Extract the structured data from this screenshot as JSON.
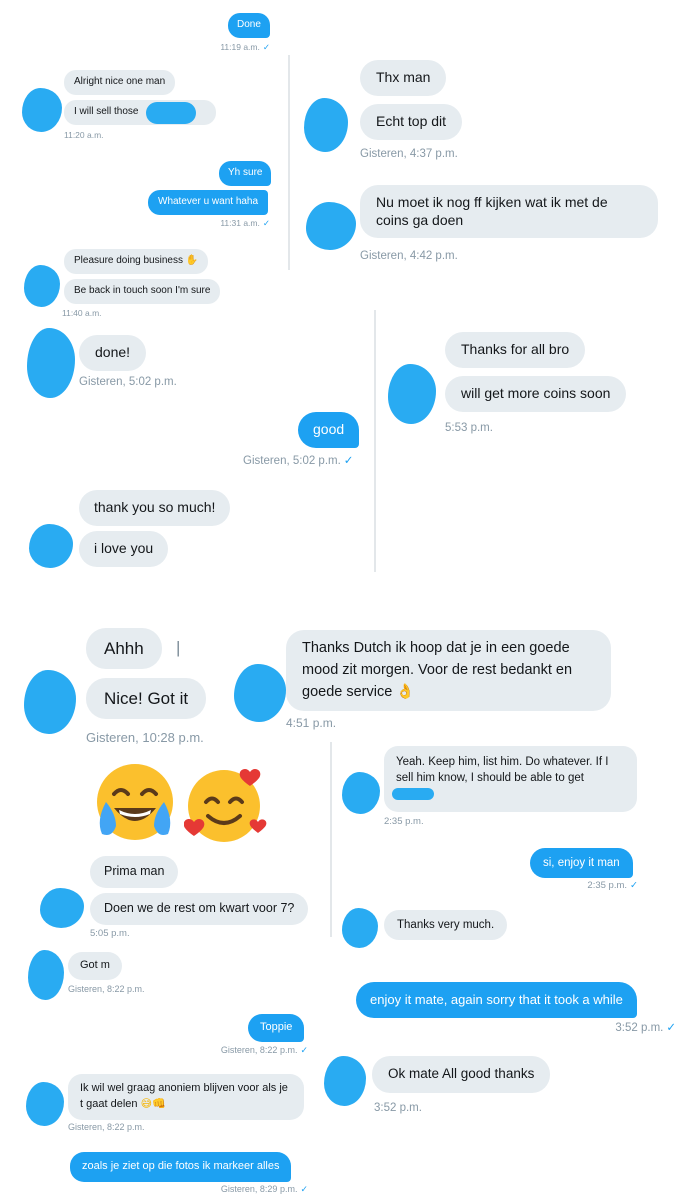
{
  "colors": {
    "outgoing": "#1da1f2",
    "incoming": "#e6ecf0",
    "redaction": "#29abf2",
    "timestamp": "#8899a6"
  },
  "p1": {
    "m1": "Done",
    "t1": "11:19 a.m.",
    "m2": "Alright nice one man",
    "m3": "I will sell those",
    "t2": "11:20 a.m.",
    "m4": "Yh sure",
    "m5": "Whatever u want haha",
    "t3": "11:31 a.m.",
    "m6": "Pleasure doing business",
    "m7": "Be back in touch soon I'm sure",
    "t4": "11:40 a.m."
  },
  "p2": {
    "m1": "Thx man",
    "m2": "Echt top dit",
    "t1": "Gisteren, 4:37 p.m.",
    "m3": "Nu moet ik nog ff kijken wat ik met de coins ga doen",
    "t2": "Gisteren, 4:42 p.m."
  },
  "p3": {
    "m1": "done!",
    "t1": "Gisteren, 5:02 p.m.",
    "m2": "good",
    "t2": "Gisteren, 5:02 p.m.",
    "m3": "thank you so much!",
    "m4": "i love you"
  },
  "p4": {
    "m1": "Thanks for all bro",
    "m2": "will get more coins soon",
    "t1": "5:53 p.m."
  },
  "p5": {
    "m1": "Ahhh",
    "m2": "Nice! Got it",
    "t1": "Gisteren, 10:28 p.m."
  },
  "p6": {
    "m1": "Thanks Dutch ik hoop dat je in een goede mood zit morgen. Voor de rest bedankt en goede service",
    "t1": "4:51 p.m."
  },
  "p7": {
    "m1": "Prima man",
    "m2": "Doen we de rest om kwart voor 7?",
    "t1": "5:05 p.m."
  },
  "p8": {
    "m1": "Yeah. Keep him, list him. Do whatever. If I sell him know, I should be able to get",
    "t1": "2:35 p.m.",
    "m2": "si, enjoy it man",
    "t2": "2:35 p.m.",
    "m3": "Thanks very much."
  },
  "p9": {
    "m1": "Got m",
    "t1": "Gisteren, 8:22 p.m.",
    "m2": "Toppie",
    "t2": "Gisteren, 8:22 p.m.",
    "m3": "Ik wil wel graag anoniem blijven voor als je t gaat delen",
    "t3": "Gisteren, 8:22 p.m.",
    "m4": "zoals je ziet op die fotos ik markeer alles",
    "t4": "Gisteren, 8:29 p.m."
  },
  "p10": {
    "m1": "enjoy it mate, again sorry that it took a while",
    "t1": "3:52 p.m."
  },
  "p11": {
    "m1": "Ok mate All good thanks",
    "t1": "3:52 p.m."
  }
}
